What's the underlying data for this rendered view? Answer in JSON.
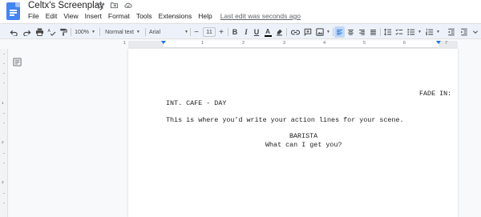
{
  "title": "Celtx's Screenplay",
  "menu": [
    "File",
    "Edit",
    "View",
    "Insert",
    "Format",
    "Tools",
    "Extensions",
    "Help"
  ],
  "last_edit": "Last edit was seconds ago",
  "toolbar": {
    "zoom": "100%",
    "style": "Normal text",
    "font": "Arial",
    "font_size": "11",
    "bold": "B",
    "italic": "I",
    "underline": "U",
    "text_color": "A",
    "minus": "−",
    "plus": "+"
  },
  "ruler": {
    "numbers": [
      "1",
      "1",
      "2",
      "3",
      "4",
      "5",
      "6",
      "7"
    ]
  },
  "vruler": [
    "1",
    "2",
    "3"
  ],
  "screenplay": {
    "transition": "FADE IN:",
    "scene_heading": "INT. CAFE - DAY",
    "action": "This is where you’d write your action lines for your scene.",
    "character": "BARISTA",
    "dialogue": "What can I get you?"
  },
  "colors": {
    "docs_blue": "#4285f4",
    "toolbar_bg": "#edf2fa",
    "accent": "#1a73e8"
  },
  "icons": [
    "star-icon",
    "folder-move-icon",
    "cloud-saved-icon",
    "undo-icon",
    "redo-icon",
    "print-icon",
    "spellcheck-icon",
    "paint-format-icon",
    "highlighter-icon",
    "link-icon",
    "comment-icon",
    "image-icon",
    "align-left-icon",
    "align-center-icon",
    "align-right-icon",
    "align-justify-icon",
    "line-spacing-icon",
    "checklist-icon",
    "bulleted-list-icon",
    "numbered-list-icon",
    "expand-icon",
    "outline-icon"
  ]
}
